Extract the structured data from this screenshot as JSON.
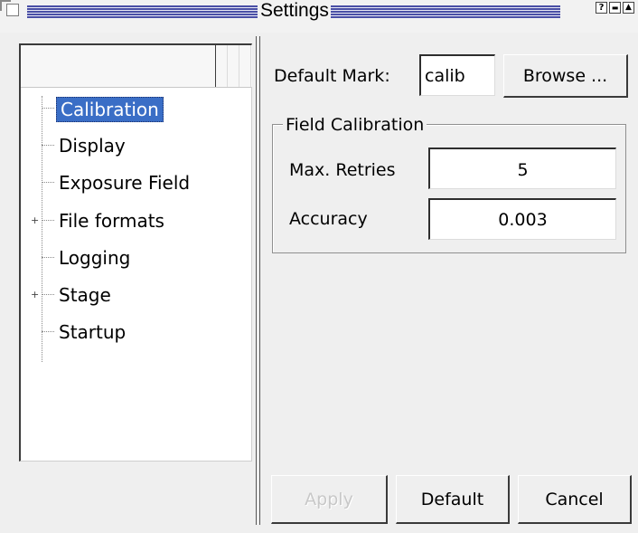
{
  "window": {
    "title": "Settings",
    "help_glyph": "?",
    "minimize_glyph": "▬",
    "maximize_glyph": "▲"
  },
  "tree": {
    "items": [
      {
        "label": "Calibration",
        "selected": true,
        "expandable": false
      },
      {
        "label": "Display",
        "selected": false,
        "expandable": false
      },
      {
        "label": "Exposure Field",
        "selected": false,
        "expandable": false
      },
      {
        "label": "File formats",
        "selected": false,
        "expandable": true
      },
      {
        "label": "Logging",
        "selected": false,
        "expandable": false
      },
      {
        "label": "Stage",
        "selected": false,
        "expandable": true
      },
      {
        "label": "Startup",
        "selected": false,
        "expandable": false
      }
    ],
    "expand_glyph": "+"
  },
  "settings": {
    "default_mark_label": "Default Mark:",
    "default_mark_value": "calib",
    "browse_label": "Browse ...",
    "group_title": "Field Calibration",
    "max_retries_label": "Max. Retries",
    "max_retries_value": "5",
    "accuracy_label": "Accuracy",
    "accuracy_value": "0.003"
  },
  "footer": {
    "apply_label": "Apply",
    "default_label": "Default",
    "cancel_label": "Cancel"
  },
  "colors": {
    "selection": "#3a6ec6",
    "title_stripe": "#4a4fa6",
    "background": "#efefef"
  }
}
